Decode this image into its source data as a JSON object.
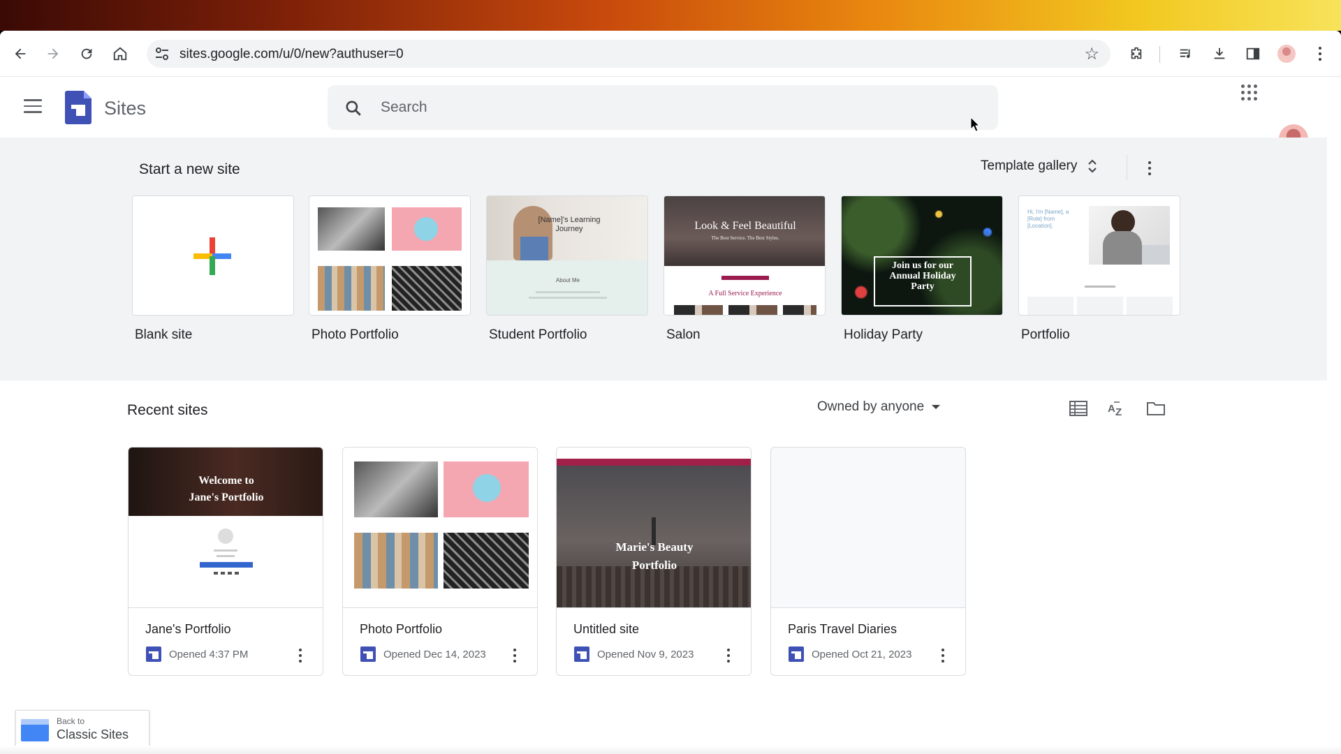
{
  "browser": {
    "url": "sites.google.com/u/0/new?authuser=0",
    "icons": [
      "back-icon",
      "forward-icon",
      "reload-icon",
      "home-icon",
      "site-settings-icon",
      "bookmark-star-icon",
      "extensions-icon",
      "media-controls-icon",
      "download-icon",
      "side-panel-icon",
      "profile-avatar",
      "browser-menu-icon"
    ]
  },
  "header": {
    "app_name": "Sites",
    "search_placeholder": "Search"
  },
  "templates": {
    "section_title": "Start a new site",
    "gallery_label": "Template gallery",
    "items": [
      {
        "label": "Blank site"
      },
      {
        "label": "Photo Portfolio"
      },
      {
        "label": "Student Portfolio",
        "thumb_text": "[Name]'s Learning Journey",
        "thumb_sub": "About Me"
      },
      {
        "label": "Salon",
        "thumb_text": "Look & Feel Beautiful",
        "thumb_sub": "The Best Service. The Best Styles.",
        "thumb_sub2": "A Full Service Experience"
      },
      {
        "label": "Holiday Party",
        "thumb_text": "Join us for our Annual Holiday Party"
      },
      {
        "label": "Portfolio",
        "thumb_text": "Hi, I'm [Name], a [Role] from [Location]."
      }
    ]
  },
  "recent": {
    "section_title": "Recent sites",
    "owner_filter": "Owned by anyone",
    "sites": [
      {
        "name": "Jane's Portfolio",
        "opened": "Opened 4:37 PM",
        "thumb_text": "Welcome to Jane's Portfolio"
      },
      {
        "name": "Photo Portfolio",
        "opened": "Opened Dec 14, 2023",
        "thumb_text": ""
      },
      {
        "name": "Untitled site",
        "opened": "Opened Nov 9, 2023",
        "thumb_text": "Marie's Beauty Portfolio"
      },
      {
        "name": "Paris Travel Diaries",
        "opened": "Opened Oct 21, 2023",
        "thumb_text": ""
      }
    ]
  },
  "classic": {
    "line1": "Back to",
    "line2": "Classic Sites"
  },
  "colors": {
    "sites_brand": "#3f51b5",
    "surface": "#f1f3f4",
    "text_primary": "#202124",
    "text_secondary": "#5f6368"
  }
}
